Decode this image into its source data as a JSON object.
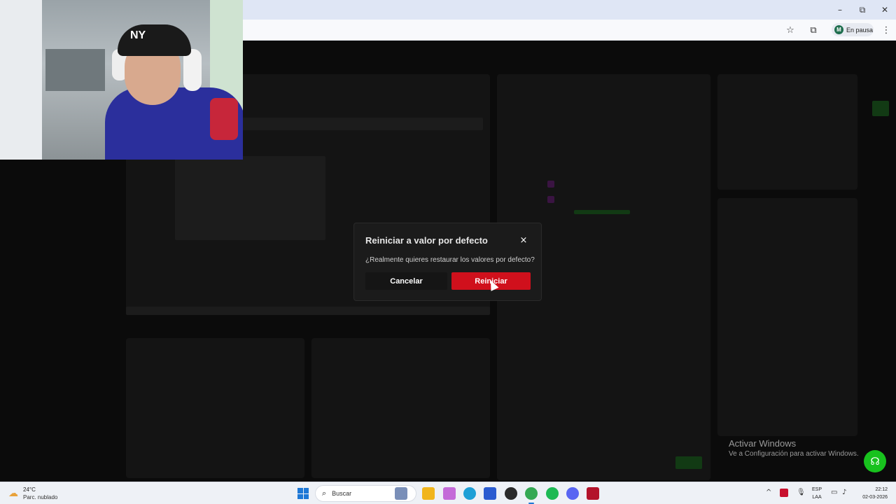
{
  "browser": {
    "profile_initial": "M",
    "profile_status": "En pausa",
    "window_controls": {
      "minimize": "–",
      "maximize": "⧉",
      "close": "✕"
    },
    "icons": [
      "star-icon",
      "extensions-icon",
      "menu-icon"
    ]
  },
  "dialog": {
    "title": "Reiniciar a valor por defecto",
    "close_label": "×",
    "message": "¿Realmente quieres restaurar los valores por defecto?",
    "cancel_label": "Cancelar",
    "confirm_label": "Reiniciar",
    "confirm_color": "#d0101c"
  },
  "watermark": {
    "title": "Activar Windows",
    "subtitle": "Ve a Configuración para activar Windows."
  },
  "webcam": {
    "cap_logo": "NY"
  },
  "taskbar": {
    "weather_temp": "24°C",
    "weather_desc": "Parc. nublado",
    "search_placeholder": "Buscar",
    "lang_1": "ESP",
    "lang_2": "LAA",
    "time": "22:12",
    "date": "02-03-2026",
    "accent": "#1e78d6"
  }
}
